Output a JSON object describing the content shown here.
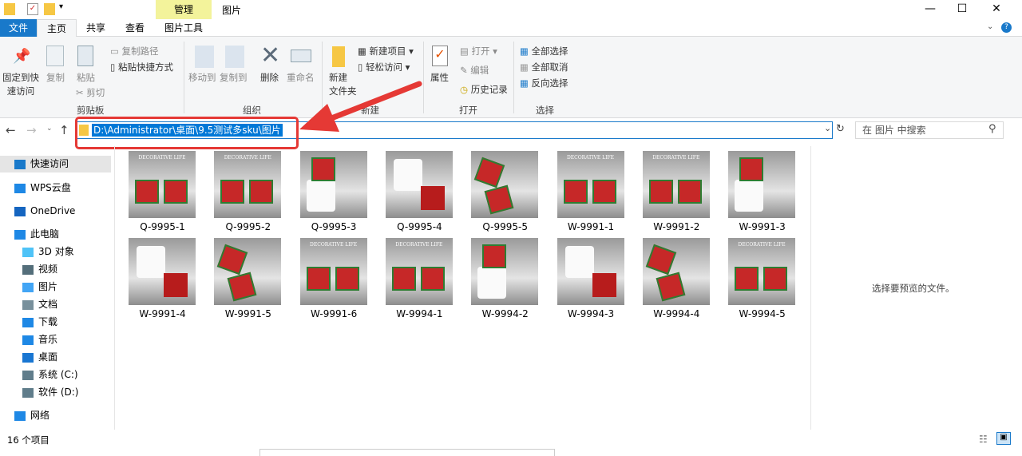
{
  "window": {
    "title": "图片",
    "context_tab": "管理",
    "minimize": "—",
    "maximize": "☐",
    "close": "✕"
  },
  "tabs": [
    "文件",
    "主页",
    "共享",
    "查看",
    "图片工具"
  ],
  "ribbon": {
    "clipboard": {
      "pin": "固定到快速访问",
      "copy": "复制",
      "paste": "粘贴",
      "copy_path": "复制路径",
      "paste_shortcut": "粘贴快捷方式",
      "cut": "剪切",
      "group": "剪贴板"
    },
    "organize": {
      "move_to": "移动到",
      "copy_to": "复制到",
      "delete": "删除",
      "rename": "重命名",
      "group": "组织"
    },
    "new": {
      "new_folder_1": "新建",
      "new_folder_2": "文件夹",
      "new_item": "新建项目",
      "easy_access": "轻松访问",
      "group": "新建"
    },
    "open": {
      "properties": "属性",
      "open": "打开",
      "edit": "编辑",
      "history": "历史记录",
      "group": "打开"
    },
    "select": {
      "select_all": "全部选择",
      "select_none": "全部取消",
      "invert": "反向选择",
      "group": "选择"
    }
  },
  "address": {
    "path": "D:\\Administrator\\桌面\\9.5测试多sku\\图片",
    "search_placeholder": "在 图片 中搜索"
  },
  "sidebar": [
    {
      "label": "快速访问",
      "icon": "star-icon"
    },
    {
      "label": "WPS云盘",
      "icon": "cloud-icon"
    },
    {
      "label": "OneDrive",
      "icon": "onedrive-icon"
    },
    {
      "label": "此电脑",
      "icon": "computer-icon"
    },
    {
      "label": "3D 对象",
      "icon": "3d-icon"
    },
    {
      "label": "视频",
      "icon": "video-icon"
    },
    {
      "label": "图片",
      "icon": "picture-icon"
    },
    {
      "label": "文档",
      "icon": "document-icon"
    },
    {
      "label": "下载",
      "icon": "download-icon"
    },
    {
      "label": "音乐",
      "icon": "music-icon"
    },
    {
      "label": "桌面",
      "icon": "desktop-icon"
    },
    {
      "label": "系统 (C:)",
      "icon": "drive-icon"
    },
    {
      "label": "软件 (D:)",
      "icon": "drive-icon"
    },
    {
      "label": "网络",
      "icon": "network-icon"
    }
  ],
  "files": [
    "Q-9995-1",
    "Q-9995-2",
    "Q-9995-3",
    "Q-9995-4",
    "Q-9995-5",
    "W-9991-1",
    "W-9991-2",
    "W-9991-3",
    "W-9991-4",
    "W-9991-5",
    "W-9991-6",
    "W-9994-1",
    "W-9994-2",
    "W-9994-3",
    "W-9994-4",
    "W-9994-5"
  ],
  "thumb_text": "DECORATIVE LIFE",
  "preview_text": "选择要预览的文件。",
  "status": "16 个项目"
}
